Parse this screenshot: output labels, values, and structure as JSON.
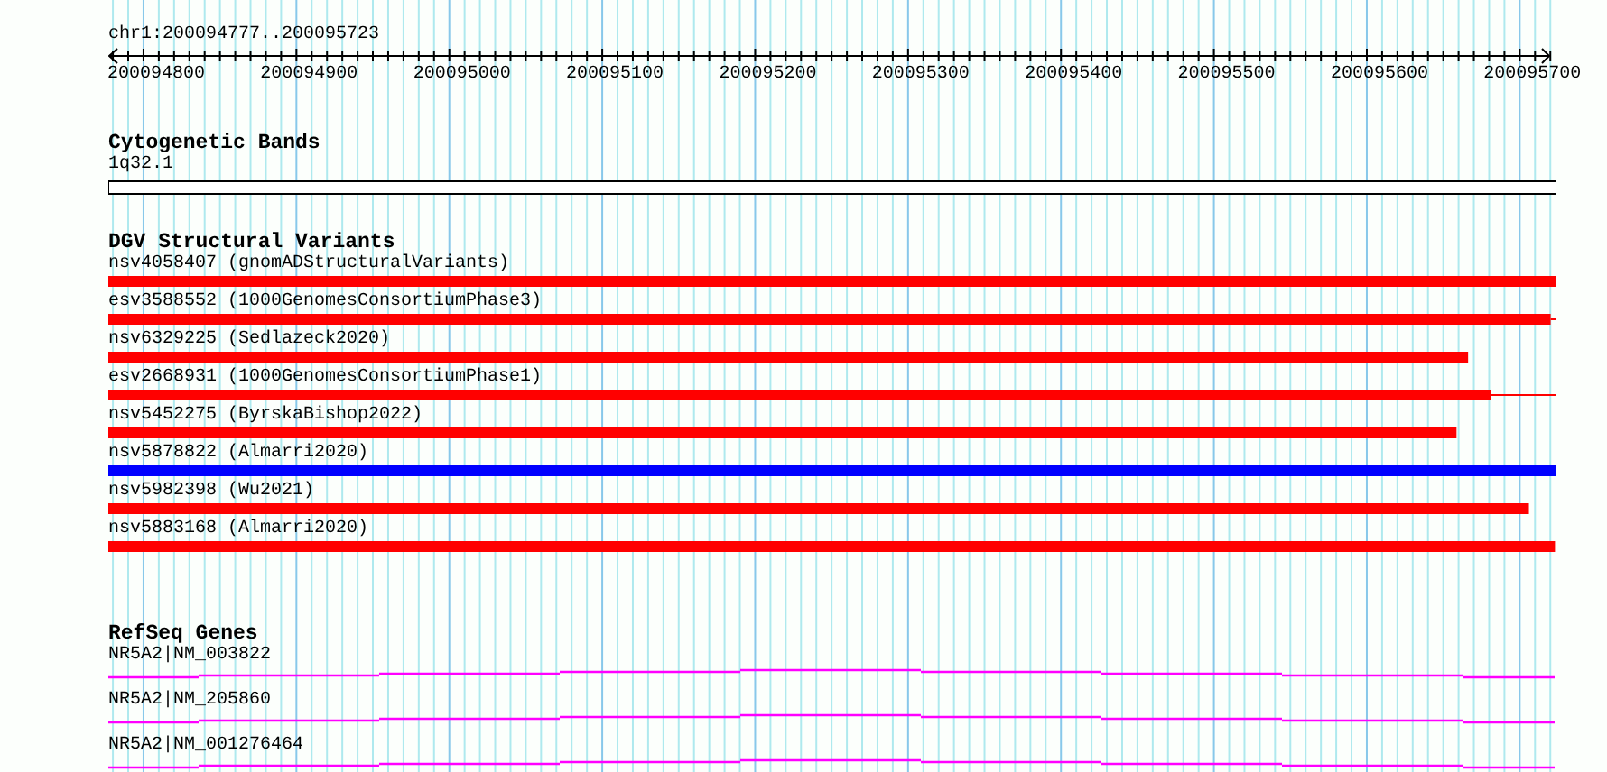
{
  "location": "chr1:200094777..200095723",
  "ruler": {
    "labels": [
      "200094800",
      "200094900",
      "200095000",
      "200095100",
      "200095200",
      "200095300",
      "200095400",
      "200095500",
      "200095600",
      "200095700"
    ]
  },
  "cytoband_track": {
    "title": "Cytogenetic Bands",
    "band": "1q32.1"
  },
  "dgv_track": {
    "title": "DGV Structural Variants",
    "variants": [
      {
        "label": "nsv4058407 (gnomADStructuralVariants)",
        "color": "#ff0000",
        "level": 1.0
      },
      {
        "label": "esv3588552 (1000GenomesConsortiumPhase3)",
        "color": "#ff0000",
        "level": 0.996,
        "thin_tail": true
      },
      {
        "label": "nsv6329225 (Sedlazeck2020)",
        "color": "#ff0000",
        "level": 0.939,
        "thin_tail": false
      },
      {
        "label": "esv2668931 (1000GenomesConsortiumPhase1)",
        "color": "#ff0000",
        "level": 0.955,
        "thin_tail": true
      },
      {
        "label": "nsv5452275 (ByrskaBishop2022)",
        "color": "#ff0000",
        "level": 0.931,
        "thin_tail": false
      },
      {
        "label": "nsv5878822 (Almarri2020)",
        "color": "#0000ff",
        "level": 1.0
      },
      {
        "label": "nsv5982398 (Wu2021)",
        "color": "#ff0000",
        "level": 0.981,
        "thin_tail": false
      },
      {
        "label": "nsv5883168 (Almarri2020)",
        "color": "#ff0000",
        "level": 0.999,
        "thin_tail": false
      }
    ]
  },
  "refseq_track": {
    "title": "RefSeq Genes",
    "genes": [
      {
        "label": "NR5A2|NM_003822"
      },
      {
        "label": "NR5A2|NM_205860"
      },
      {
        "label": "NR5A2|NM_001276464"
      }
    ]
  }
}
